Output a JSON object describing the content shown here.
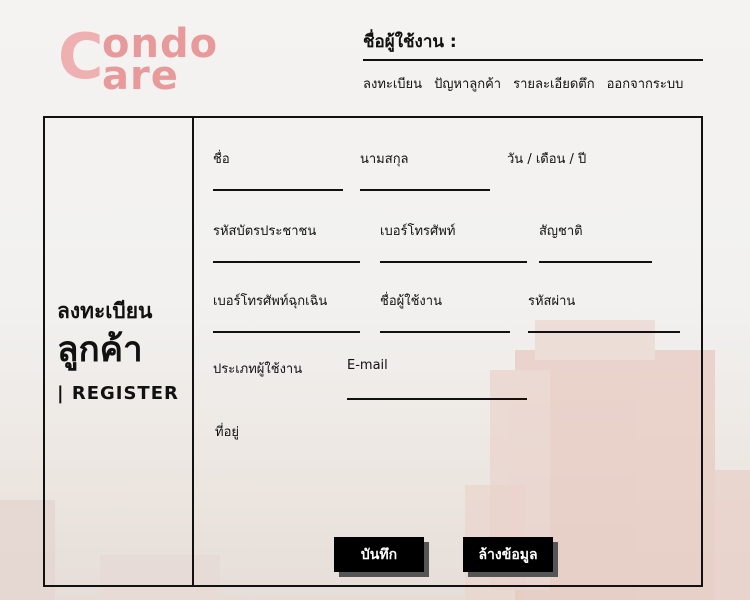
{
  "logo": {
    "c": "C",
    "ondo": "ondo",
    "are": "are"
  },
  "header": {
    "username_label": "ชื่อผู้ใช้งาน :",
    "nav": [
      "ลงทะเบียน",
      "ปัญหาลูกค้า",
      "รายละเอียดตึก",
      "ออกจากระบบ"
    ]
  },
  "side": {
    "title1": "ลงทะเบียน",
    "title2": "ลูกค้า",
    "title3": "| REGISTER"
  },
  "form": {
    "first_name": "ชื่อ",
    "last_name": "นามสกุล",
    "dob": "วัน / เดือน / ปี",
    "id_card": "รหัสบัตรประชาชน",
    "phone": "เบอร์โทรศัพท์",
    "nationality": "สัญชาติ",
    "emergency_phone": "เบอร์โทรศัพท์ฉุกเฉิน",
    "username": "ชื่อผู้ใช้งาน",
    "password": "รหัสผ่าน",
    "user_type": "ประเภทผู้ใช้งาน",
    "email": "E-mail",
    "address": "ที่อยู่"
  },
  "buttons": {
    "save": "บันทึก",
    "clear": "ล้างข้อมูล"
  }
}
